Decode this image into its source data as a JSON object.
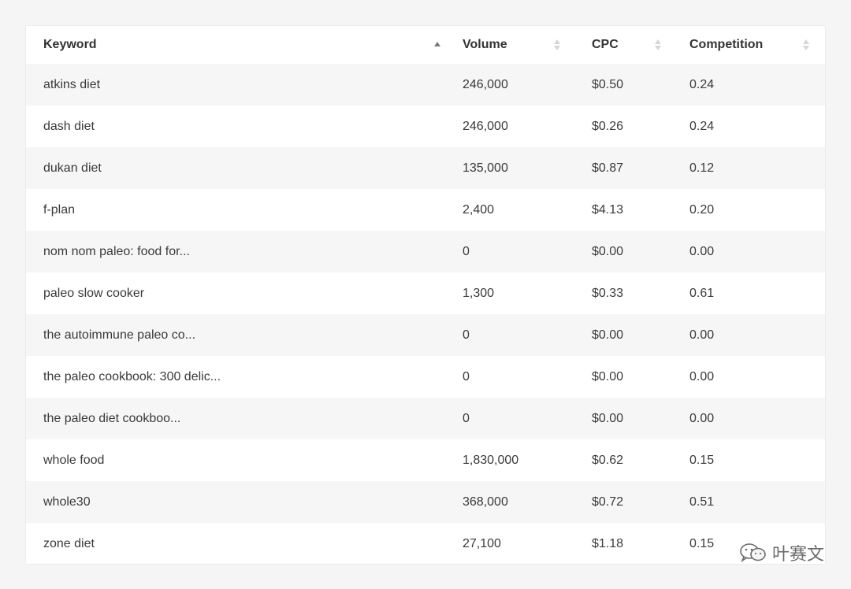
{
  "table": {
    "columns": [
      {
        "label": "Keyword",
        "sort": "ascending"
      },
      {
        "label": "Volume",
        "sort": "none"
      },
      {
        "label": "CPC",
        "sort": "none"
      },
      {
        "label": "Competition",
        "sort": "none"
      }
    ],
    "rows": [
      {
        "keyword": "atkins diet",
        "volume": "246,000",
        "cpc": "$0.50",
        "competition": "0.24"
      },
      {
        "keyword": "dash diet",
        "volume": "246,000",
        "cpc": "$0.26",
        "competition": "0.24"
      },
      {
        "keyword": "dukan diet",
        "volume": "135,000",
        "cpc": "$0.87",
        "competition": "0.12"
      },
      {
        "keyword": "f-plan",
        "volume": "2,400",
        "cpc": "$4.13",
        "competition": "0.20"
      },
      {
        "keyword": "nom nom paleo: food for...",
        "volume": "0",
        "cpc": "$0.00",
        "competition": "0.00"
      },
      {
        "keyword": "paleo slow cooker",
        "volume": "1,300",
        "cpc": "$0.33",
        "competition": "0.61"
      },
      {
        "keyword": "the autoimmune paleo co...",
        "volume": "0",
        "cpc": "$0.00",
        "competition": "0.00"
      },
      {
        "keyword": "the paleo cookbook: 300 delic...",
        "volume": "0",
        "cpc": "$0.00",
        "competition": "0.00"
      },
      {
        "keyword": "the paleo diet cookboo...",
        "volume": "0",
        "cpc": "$0.00",
        "competition": "0.00"
      },
      {
        "keyword": "whole food",
        "volume": "1,830,000",
        "cpc": "$0.62",
        "competition": "0.15"
      },
      {
        "keyword": "whole30",
        "volume": "368,000",
        "cpc": "$0.72",
        "competition": "0.51"
      },
      {
        "keyword": "zone diet",
        "volume": "27,100",
        "cpc": "$1.18",
        "competition": "0.15"
      }
    ]
  },
  "watermark": {
    "text": "叶赛文",
    "icon": "wechat-icon"
  }
}
